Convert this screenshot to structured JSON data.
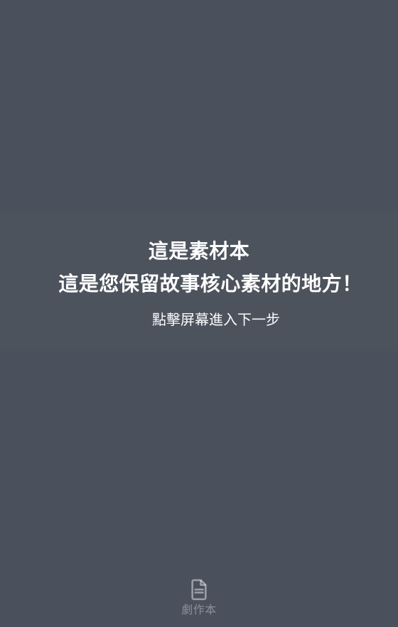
{
  "overlay": {
    "title": "這是素材本",
    "subtitle": "這是您保留故事核心素材的地方！",
    "hint": "點擊屏幕進入下一步"
  },
  "bottom_tab": {
    "active_item": {
      "label": "劇作本",
      "icon": "document-icon"
    }
  },
  "colors": {
    "background": "#4b515c",
    "text_primary": "#ffffff",
    "tab_text": "rgba(255,255,255,0.35)"
  }
}
